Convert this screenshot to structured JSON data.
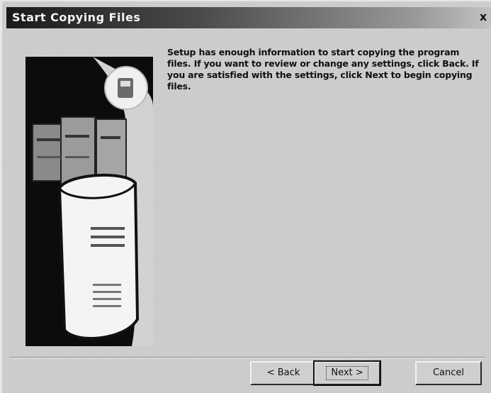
{
  "window": {
    "title": "Start Copying Files",
    "close_glyph": "x"
  },
  "message": "Setup has enough information to start copying the program files. If you want to review or change any settings, click Back. If you are satisfied with the settings, click Next to begin copying files.",
  "buttons": {
    "back": "< Back",
    "next": "Next >",
    "cancel": "Cancel"
  }
}
